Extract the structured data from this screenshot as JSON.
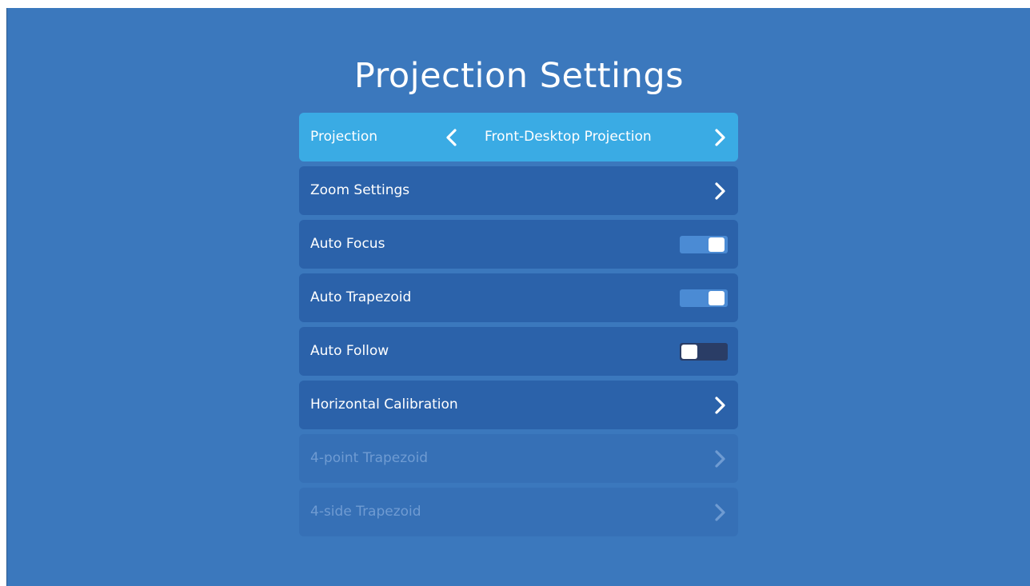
{
  "page": {
    "title": "Projection Settings"
  },
  "colors": {
    "background": "#3b78bd",
    "row": "#2b62aa",
    "row_selected": "#3aabe4",
    "row_disabled": "#3670b6",
    "toggle_on": "#4b8bd4",
    "toggle_off": "#2a3d66"
  },
  "menu": {
    "items": [
      {
        "label": "Projection",
        "value": "Front-Desktop Projection",
        "type": "selector",
        "selected": true,
        "icons": [
          "chevron-left-icon",
          "chevron-right-icon"
        ]
      },
      {
        "label": "Zoom Settings",
        "type": "submenu",
        "icons": [
          "chevron-right-icon"
        ]
      },
      {
        "label": "Auto Focus",
        "type": "toggle",
        "on": true
      },
      {
        "label": "Auto Trapezoid",
        "type": "toggle",
        "on": true
      },
      {
        "label": "Auto Follow",
        "type": "toggle",
        "on": false
      },
      {
        "label": "Horizontal Calibration",
        "type": "submenu",
        "icons": [
          "chevron-right-icon"
        ]
      },
      {
        "label": "4-point Trapezoid",
        "type": "submenu",
        "disabled": true,
        "icons": [
          "chevron-right-icon"
        ]
      },
      {
        "label": "4-side Trapezoid",
        "type": "submenu",
        "disabled": true,
        "icons": [
          "chevron-right-icon"
        ]
      }
    ]
  }
}
